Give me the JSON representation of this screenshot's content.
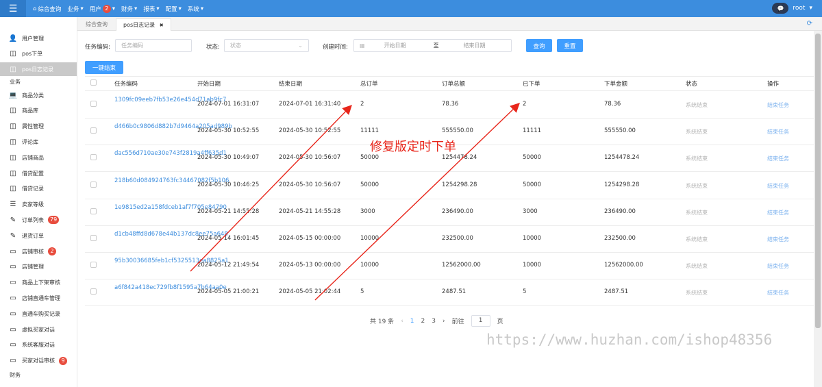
{
  "topbar": {
    "menu_icon": "hamburger-icon",
    "nav": [
      {
        "label": "综合查询",
        "icon": "home-icon"
      },
      {
        "label": "业务",
        "arrow": "▾"
      },
      {
        "label": "用户",
        "badge": "2",
        "arrow": "▾"
      },
      {
        "label": "财务",
        "arrow": "▾"
      },
      {
        "label": "报表",
        "arrow": "▾"
      },
      {
        "label": "配置",
        "arrow": "▾"
      },
      {
        "label": "系统",
        "arrow": "▾"
      }
    ],
    "user": "root",
    "user_arrow": "▾"
  },
  "sidebar": {
    "items_top": [
      {
        "label": "用户管理",
        "icon": "user-icon"
      },
      {
        "label": "pos下单",
        "icon": "columns-icon"
      },
      {
        "label": "pos日志记录",
        "icon": "columns-icon",
        "active": true
      }
    ],
    "section_business": "业务",
    "items": [
      {
        "label": "商品分类",
        "icon": "laptop-icon"
      },
      {
        "label": "商品库",
        "icon": "columns-icon"
      },
      {
        "label": "属性管理",
        "icon": "columns-icon"
      },
      {
        "label": "评论库",
        "icon": "columns-icon"
      },
      {
        "label": "店铺商品",
        "icon": "columns-icon"
      },
      {
        "label": "借贷配置",
        "icon": "columns-icon"
      },
      {
        "label": "借贷记录",
        "icon": "columns-icon"
      },
      {
        "label": "卖家等级",
        "icon": "list-icon"
      },
      {
        "label": "订单列表",
        "icon": "pencil-icon",
        "badge": "79"
      },
      {
        "label": "退货订单",
        "icon": "pencil-icon"
      },
      {
        "label": "店铺审核",
        "icon": "card-icon",
        "badge": "2"
      },
      {
        "label": "店铺管理",
        "icon": "card-icon"
      },
      {
        "label": "商品上下架审核",
        "icon": "card-icon"
      },
      {
        "label": "店铺直通车管理",
        "icon": "card-icon"
      },
      {
        "label": "直通车购买记录",
        "icon": "card-icon"
      },
      {
        "label": "虚拟买家对话",
        "icon": "card-icon"
      },
      {
        "label": "系统客服对话",
        "icon": "card-icon"
      },
      {
        "label": "买家对话审核",
        "icon": "card-icon",
        "badge": "9"
      }
    ],
    "section_finance": "财务"
  },
  "tabs": [
    {
      "label": "综合查询"
    },
    {
      "label": "pos日志记录",
      "close": "✖"
    }
  ],
  "filters": {
    "task_label": "任务编码:",
    "task_placeholder": "任务编码",
    "status_label": "状态:",
    "status_placeholder": "状态",
    "created_label": "创建时间:",
    "start_placeholder": "开始日期",
    "range_sep": "至",
    "end_placeholder": "结束日期",
    "query_button": "查询",
    "reset_button": "重置",
    "batch_end_button": "一键结束"
  },
  "table": {
    "headers": [
      "任务编码",
      "开始日期",
      "结束日期",
      "总订单",
      "订单总额",
      "已下单",
      "下单金额",
      "状态",
      "操作"
    ],
    "rows": [
      {
        "code": "1309fc09eeb7fb53e26e454d71ab9fc7",
        "start": "2024-07-01 16:31:07",
        "end": "2024-07-01 16:31:40",
        "total_orders": "2",
        "total_amount": "78.36",
        "placed": "2",
        "placed_amount": "78.36",
        "status": "系统结束",
        "action": "结束任务"
      },
      {
        "code": "d466b0c9806d882b7d9464a205ad989b",
        "start": "2024-05-30 10:52:55",
        "end": "2024-05-30 10:52:55",
        "total_orders": "11111",
        "total_amount": "555550.00",
        "placed": "11111",
        "placed_amount": "555550.00",
        "status": "系统结束",
        "action": "结束任务"
      },
      {
        "code": "dac556d710ae30e743f2819a4ff635d1",
        "start": "2024-05-30 10:49:07",
        "end": "2024-05-30 10:56:07",
        "total_orders": "50000",
        "total_amount": "1254478.24",
        "placed": "50000",
        "placed_amount": "1254478.24",
        "status": "系统结束",
        "action": "结束任务"
      },
      {
        "code": "218b60d084924763fc34467082f5b106",
        "start": "2024-05-30 10:46:25",
        "end": "2024-05-30 10:56:07",
        "total_orders": "50000",
        "total_amount": "1254298.28",
        "placed": "50000",
        "placed_amount": "1254298.28",
        "status": "系统结束",
        "action": "结束任务"
      },
      {
        "code": "1e9815ed2a158fdceb1af7f705e84790",
        "start": "2024-05-21 14:55:28",
        "end": "2024-05-21 14:55:28",
        "total_orders": "3000",
        "total_amount": "236490.00",
        "placed": "3000",
        "placed_amount": "236490.00",
        "status": "系统结束",
        "action": "结束任务"
      },
      {
        "code": "d1cb48ffd8d678e44b137dc8ee75a648",
        "start": "2024-05-14 16:01:45",
        "end": "2024-05-15 00:00:00",
        "total_orders": "10000",
        "total_amount": "232500.00",
        "placed": "10000",
        "placed_amount": "232500.00",
        "status": "系统结束",
        "action": "结束任务"
      },
      {
        "code": "95b30036685feb1cf5325513ea8825a1",
        "start": "2024-05-12 21:49:54",
        "end": "2024-05-13 00:00:00",
        "total_orders": "10000",
        "total_amount": "12562000.00",
        "placed": "10000",
        "placed_amount": "12562000.00",
        "status": "系统结束",
        "action": "结束任务"
      },
      {
        "code": "a6f842a418ec729fb8f1595a7b64aa0e",
        "start": "2024-05-05 21:00:21",
        "end": "2024-05-05 21:02:44",
        "total_orders": "5",
        "total_amount": "2487.51",
        "placed": "5",
        "placed_amount": "2487.51",
        "status": "系统结束",
        "action": "结束任务"
      }
    ]
  },
  "pagination": {
    "total": "共 19 条",
    "prev": "‹",
    "pages": [
      "1",
      "2",
      "3"
    ],
    "current": "1",
    "next": "›",
    "goto_label": "前往",
    "goto_value": "1",
    "page_unit": "页"
  },
  "annotation": {
    "text": "修复版定时下单",
    "color": "#e8261b"
  },
  "watermark": "https://www.huzhan.com/ishop48356",
  "colors": {
    "topbar": "#3c8dde",
    "primary": "#409eff",
    "link": "#3c8dde",
    "badge": "#e84c3d"
  }
}
